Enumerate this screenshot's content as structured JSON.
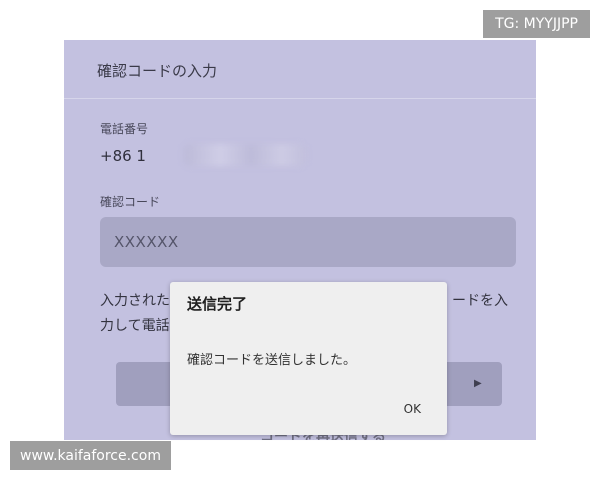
{
  "panel": {
    "title": "確認コードの入力",
    "phone_label": "電話番号",
    "phone_value": "+86 1",
    "code_label": "確認コード",
    "code_value": "XXXXXX",
    "instruction_left_1": "入力された",
    "instruction_left_2": "力して電話",
    "instruction_right_1": "ードを入",
    "send_arrow": "▶",
    "resend_text": "コードを再送信する"
  },
  "dialog": {
    "title": "送信完了",
    "message": "確認コードを送信しました。",
    "ok_label": "OK"
  },
  "watermarks": {
    "top": "TG: MYYJJPP",
    "bottom": "www.kaifaforce.com"
  }
}
